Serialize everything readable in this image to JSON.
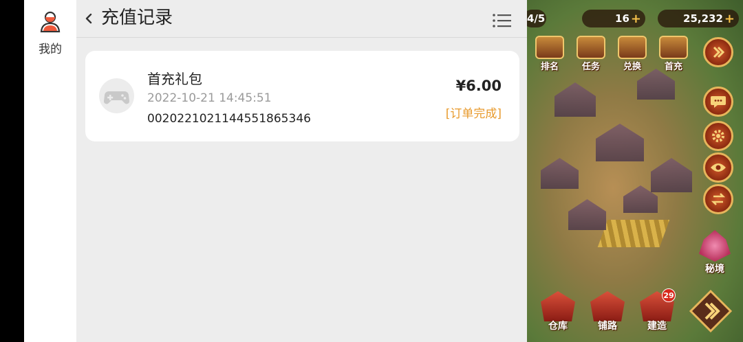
{
  "side_nav": {
    "my_label": "我的"
  },
  "header": {
    "title": "充值记录"
  },
  "order": {
    "name": "首充礼包",
    "time": "2022-10-21 14:45:51",
    "order_no": "002022102114455186​5346",
    "amount": "¥6.00",
    "status": "[订单完成]"
  },
  "game_hud": {
    "progress": "4/5",
    "gems": "16",
    "gold": "25,232",
    "top_buttons": [
      "排名",
      "任务",
      "兑换",
      "首充"
    ],
    "bottom_buttons": [
      "仓库",
      "铺路",
      "建造"
    ],
    "build_badge": "29",
    "secret_label": "秘境"
  },
  "colors": {
    "status": "#e89a2c",
    "panel_bg": "#ededed",
    "card_bg": "#ffffff"
  }
}
